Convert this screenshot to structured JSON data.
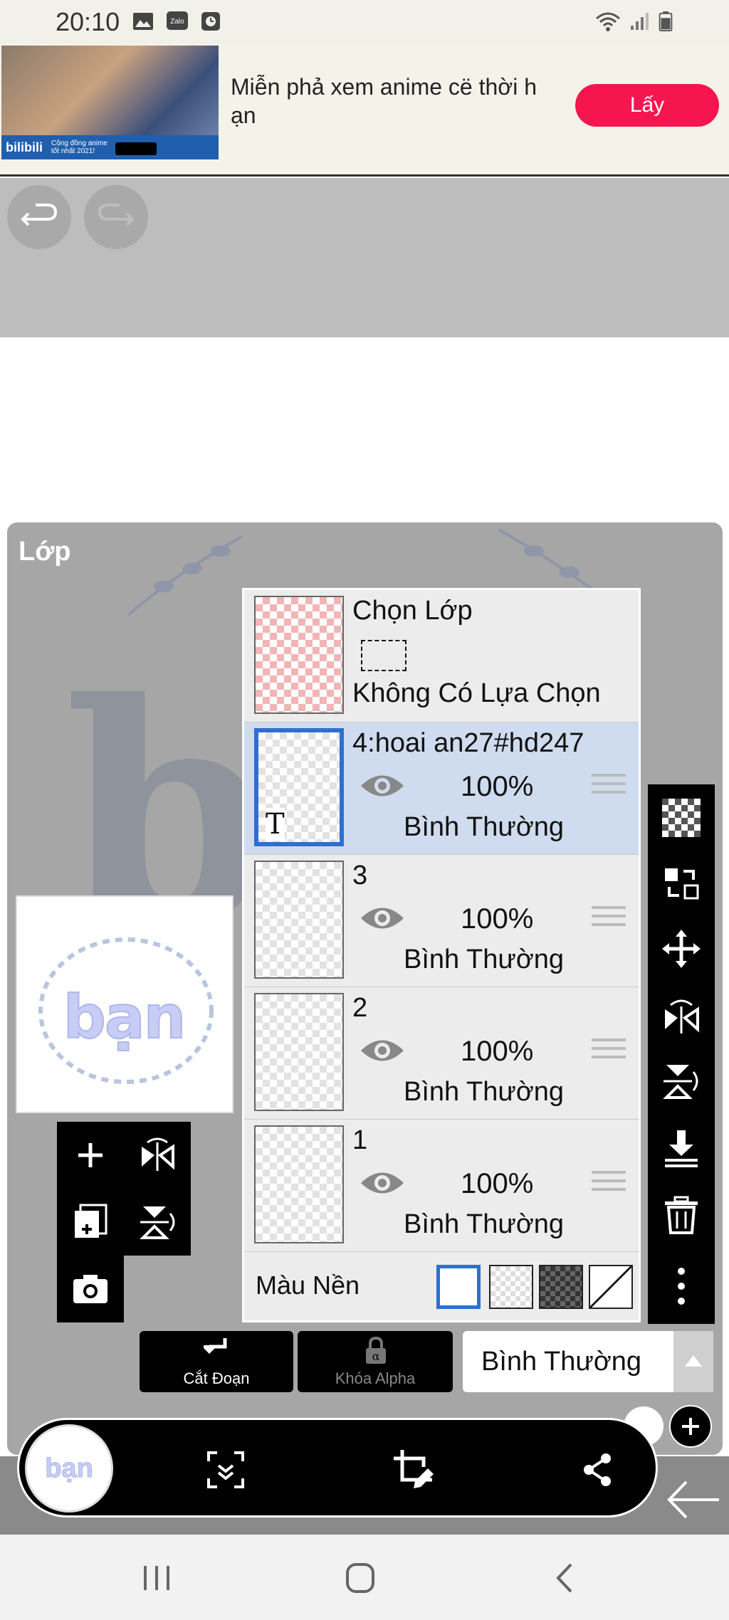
{
  "status_bar": {
    "time": "20:10",
    "notification_icons": [
      "gallery-icon",
      "zalo-icon",
      "clock-icon"
    ],
    "right_icons": [
      "wifi-icon",
      "signal-icon",
      "battery-icon"
    ],
    "zalo_label": "Zalo"
  },
  "ad": {
    "text": "Miễn phả xem anime cë thời h ạn",
    "button_label": "Lấy",
    "brand": "bilibili",
    "tagline": "Cộng đồng anime tốt nhất 2021!",
    "accent_color": "#f7154f"
  },
  "toolbar_top": {
    "undo_icon": "undo-icon",
    "redo_icon": "redo-icon"
  },
  "panel": {
    "title": "Lớp",
    "background_letter": "b"
  },
  "preview": {
    "word": "bạn"
  },
  "selection_layer": {
    "title": "Chọn Lớp",
    "status": "Không Có Lựa Chọn"
  },
  "layers": [
    {
      "name": "4:hoai an27#hd247",
      "opacity": "100%",
      "blend": "Bình Thường",
      "selected": true,
      "is_text": true,
      "thumb_badge": "T"
    },
    {
      "name": "3",
      "opacity": "100%",
      "blend": "Bình Thường",
      "selected": false
    },
    {
      "name": "2",
      "opacity": "100%",
      "blend": "Bình Thường",
      "selected": false
    },
    {
      "name": "1",
      "opacity": "100%",
      "blend": "Bình Thường",
      "selected": false
    }
  ],
  "background_row": {
    "label": "Màu Nền",
    "swatches": [
      "white",
      "transparent-light",
      "transparent-dark",
      "none"
    ],
    "selected_color": "#2e6fd0"
  },
  "bottom_controls": {
    "clip_label": "Cắt Đoạn",
    "alpha_lock_label": "Khóa Alpha",
    "blend_mode": "Bình Thường"
  },
  "pill": {
    "avatar_word": "bạn"
  }
}
